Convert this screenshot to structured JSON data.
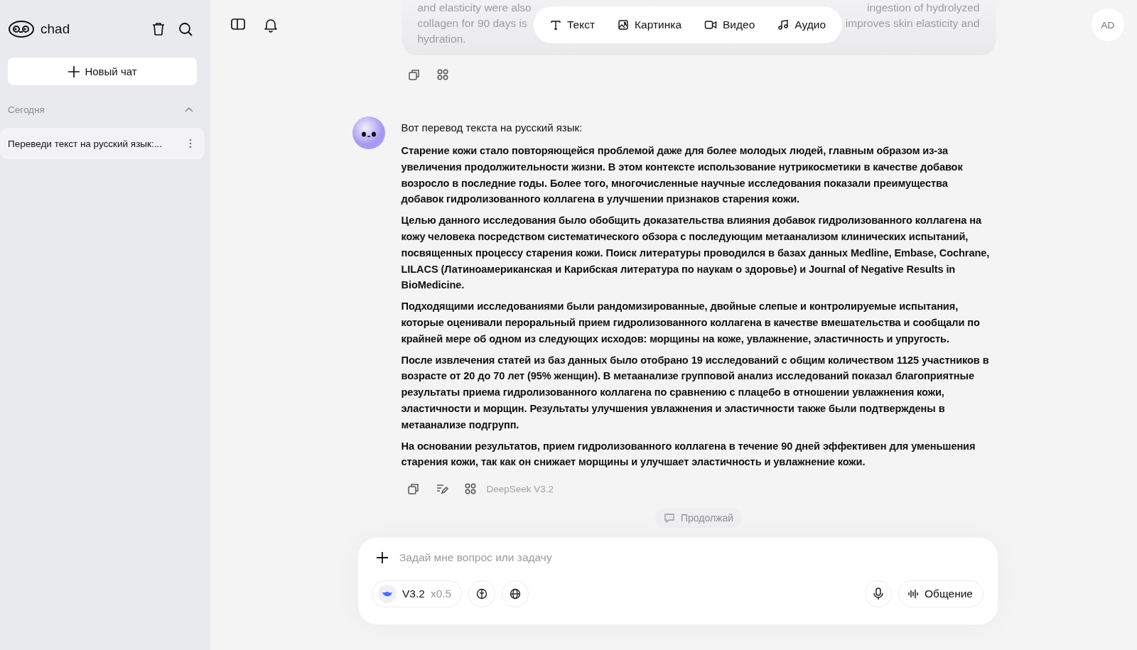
{
  "sidebar": {
    "brand": "chad",
    "new_chat": "Новый чат",
    "section": {
      "label": "Сегодня",
      "expanded": true
    },
    "chats": [
      {
        "title": "Переведи текст на русский язык:...",
        "selected": true
      }
    ]
  },
  "media_tabs": [
    {
      "label": "Текст",
      "kind": "text"
    },
    {
      "label": "Картинка",
      "kind": "image"
    },
    {
      "label": "Видео",
      "kind": "video"
    },
    {
      "label": "Аудио",
      "kind": "audio"
    }
  ],
  "avatar": "AD",
  "user_message": {
    "line_1_start": "and elasticity were also",
    "line_1_end": "ingestion of hydrolyzed",
    "line_2_start": "collagen for 90 days is",
    "line_2_end": "improves skin elasticity and",
    "line_3": "hydration."
  },
  "assistant": {
    "intro": "Вот перевод текста на русский язык:",
    "paragraphs": [
      "Старение кожи стало повторяющейся проблемой даже для более молодых людей, главным образом из-за увеличения продолжительности жизни. В этом контексте использование нутрикосметики в качестве добавок возросло в последние годы. Более того, многочисленные научные исследования показали преимущества добавок гидролизованного коллагена в улучшении признаков старения кожи.",
      "Целью данного исследования было обобщить доказательства влияния добавок гидролизованного коллагена на кожу человека посредством систематического обзора с последующим метаанализом клинических испытаний, посвященных процессу старения кожи. Поиск литературы проводился в базах данных Medline, Embase, Cochrane, LILACS (Латиноамериканская и Карибская литература по наукам о здоровье) и Journal of Negative Results in BioMedicine.",
      "Подходящими исследованиями были рандомизированные, двойные слепые и контролируемые испытания, которые оценивали пероральный прием гидролизованного коллагена в качестве вмешательства и сообщали по крайней мере об одном из следующих исходов: морщины на коже, увлажнение, эластичность и упругость.",
      "После извлечения статей из баз данных было отобрано 19 исследований с общим количеством 1125 участников в возрасте от 20 до 70 лет (95% женщин). В метаанализе групповой анализ исследований показал благоприятные результаты приема гидролизованного коллагена по сравнению с плацебо в отношении увлажнения кожи, эластичности и морщин. Результаты улучшения увлажнения и эластичности также были подтверждены в метаанализе подгрупп.",
      "На основании результатов, прием гидролизованного коллагена в течение 90 дней эффективен для уменьшения старения кожи, так как он снижает морщины и улучшает эластичность и увлажнение кожи."
    ],
    "model": "DeepSeek V3.2"
  },
  "suggestion": "Продолжай",
  "composer": {
    "placeholder": "Задай мне вопрос или задачу",
    "model": "V3.2",
    "multiplier": "x0.5",
    "voice_button": "Общение"
  }
}
